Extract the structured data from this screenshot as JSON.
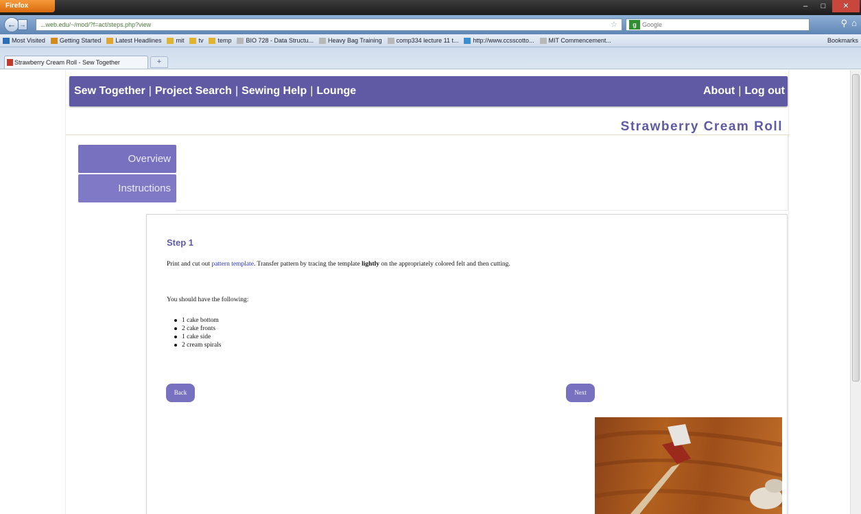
{
  "browser": {
    "app_button": "Firefox",
    "url": "...web.edu/~/mod/?f=act/steps.php?view",
    "search_engine_icon": "google-icon",
    "search_placeholder": "Google",
    "tab_title": "Strawberry Cream Roll - Sew Together",
    "new_tab": "+",
    "bookmarks": [
      "Most Visited",
      "Getting Started",
      "Latest Headlines",
      "mit",
      "tv",
      "temp",
      "BIO 728 - Data Structu...",
      "Heavy Bag Training",
      "comp334 lecture 11 t...",
      "http://www.ccsscotto...",
      "MIT Commencement..."
    ],
    "bookmarks_more": "Bookmarks"
  },
  "nav": {
    "left": [
      "Sew Together",
      "Project Search",
      "Sewing Help",
      "Lounge"
    ],
    "right": [
      "About",
      "Log out"
    ],
    "separator": "|"
  },
  "project": {
    "title": "Strawberry Cream Roll"
  },
  "side_tabs": [
    "Overview",
    "Instructions"
  ],
  "step": {
    "title": "Step 1",
    "para1_start": "Print and cut out ",
    "para1_link": "pattern template",
    "para1_mid": ". Transfer pattern by tracing the template ",
    "para1_bold": "lightly",
    "para1_end": " on the appropriately colored felt and then cutting.",
    "para2": "You should have the following:",
    "items": [
      "1 cake bottom",
      "2 cake fronts",
      "1 cake side",
      "2 cream spirals"
    ],
    "back_label": "Back",
    "next_label": "Next"
  },
  "colors": {
    "brand": "#5f5aa3",
    "tab": "#7771bf",
    "link": "#2b35c2"
  }
}
